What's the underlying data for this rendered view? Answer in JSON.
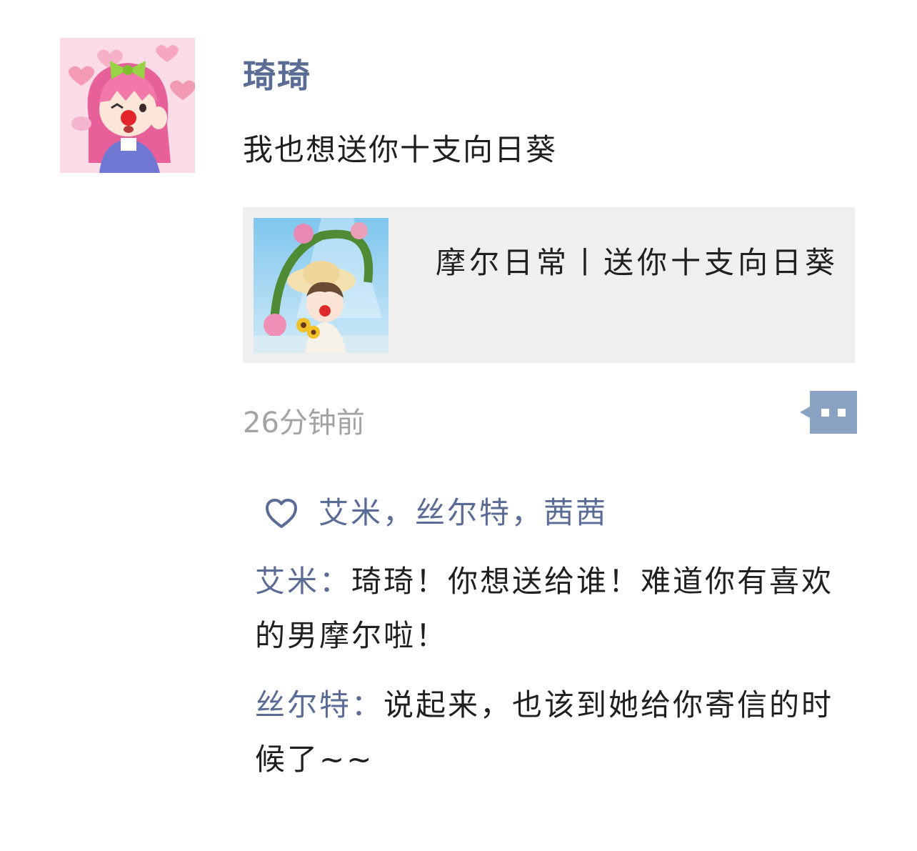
{
  "post": {
    "author": "琦琦",
    "text": "我也想送你十支向日葵",
    "avatar_icon": "pink-haired-clown-avatar",
    "share": {
      "title": "摩尔日常丨送你十支向日葵",
      "thumbnail_icon": "sunflower-mole-thumbnail"
    },
    "time": "26分钟前",
    "more_icon": "comment-more-icon"
  },
  "likes": {
    "icon": "heart-icon",
    "names": "艾米，丝尔特，茜茜"
  },
  "comments": [
    {
      "author": "艾米：",
      "text": "琦琦！你想送给谁！难道你有喜欢的男摩尔啦！"
    },
    {
      "author": "丝尔特：",
      "text": "说起来，也该到她给你寄信的时候了~~"
    }
  ],
  "colors": {
    "name_blue": "#5a6c95",
    "time_gray": "#a3a3a3",
    "card_bg": "#efefef",
    "more_button": "#8aa3c3"
  }
}
